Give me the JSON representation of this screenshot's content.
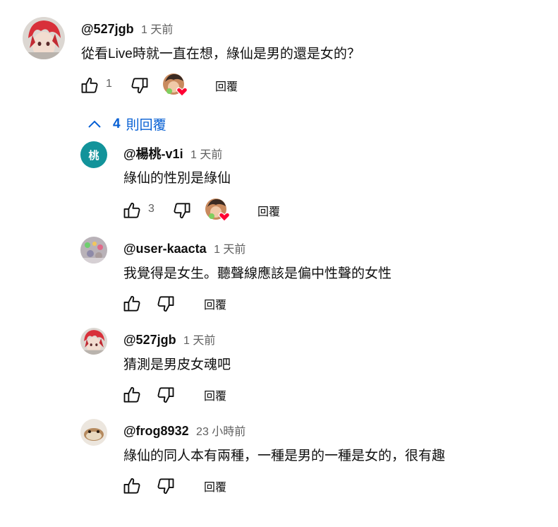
{
  "comments": [
    {
      "handle": "@527jgb",
      "time": "1 天前",
      "text": "從看Live時就一直在想，綠仙是男的還是女的？",
      "likes": "1",
      "reply_label": "回覆",
      "creator_hearted": true
    }
  ],
  "replies_toggle": {
    "count": "4",
    "label": "則回覆"
  },
  "replies": [
    {
      "handle": "@楊桃-v1i",
      "time": "1 天前",
      "text": "綠仙的性別是綠仙",
      "likes": "3",
      "reply_label": "回覆",
      "avatar_char": "桃",
      "avatar_color": "#12939a",
      "creator_hearted": true
    },
    {
      "handle": "@user-kaacta",
      "time": "1 天前",
      "text": "我覺得是女生。聽聲線應該是偏中性聲的女性",
      "likes": "",
      "reply_label": "回覆",
      "creator_hearted": false
    },
    {
      "handle": "@527jgb",
      "time": "1 天前",
      "text": "猜測是男皮女魂吧",
      "likes": "",
      "reply_label": "回覆",
      "creator_hearted": false
    },
    {
      "handle": "@frog8932",
      "time": "23 小時前",
      "text": "綠仙的同人本有兩種，一種是男的一種是女的，很有趣",
      "likes": "",
      "reply_label": "回覆",
      "creator_hearted": false
    }
  ],
  "colors": {
    "link": "#065fd4",
    "heart": "#ff0033",
    "muted": "#606060"
  }
}
